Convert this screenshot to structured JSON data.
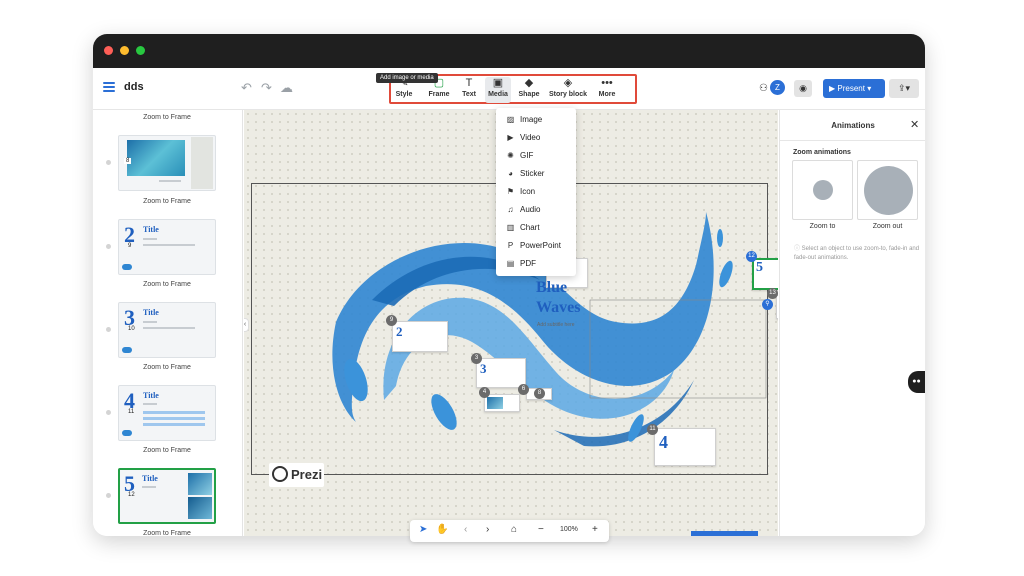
{
  "document": {
    "title": "dds"
  },
  "toolbar": {
    "undo": "↶",
    "redo": "↷",
    "cloud": "☁",
    "tools": [
      {
        "name": "Style",
        "icon": "✎"
      },
      {
        "name": "Frame",
        "icon": "▢"
      },
      {
        "name": "Text",
        "icon": "T"
      },
      {
        "name": "Media",
        "icon": "▣"
      },
      {
        "name": "Shape",
        "icon": "◆"
      },
      {
        "name": "Story block",
        "icon": "◈"
      },
      {
        "name": "More",
        "icon": "•••"
      }
    ],
    "tooltip": "Add image or media",
    "avatar_letter": "Z",
    "present_label": "Present",
    "present_icon": "▶",
    "share_icon": "⇪"
  },
  "media_menu": {
    "items": [
      {
        "label": "Image",
        "icon": "▨"
      },
      {
        "label": "Video",
        "icon": "▶"
      },
      {
        "label": "GIF",
        "icon": "✺"
      },
      {
        "label": "Sticker",
        "icon": "◕"
      },
      {
        "label": "Icon",
        "icon": "⚑"
      },
      {
        "label": "Audio",
        "icon": "♫"
      },
      {
        "label": "Chart",
        "icon": "▥"
      },
      {
        "label": "PowerPoint",
        "icon": "P"
      },
      {
        "label": "PDF",
        "icon": "▤"
      }
    ]
  },
  "left_panel": {
    "zoom_to_frame": "Zoom to Frame",
    "slides": [
      {
        "index": "8",
        "number": "",
        "title": ""
      },
      {
        "index": "9",
        "number": "2",
        "title": "Title"
      },
      {
        "index": "10",
        "number": "3",
        "title": "Title"
      },
      {
        "index": "11",
        "number": "4",
        "title": "Title"
      },
      {
        "index": "12",
        "number": "5",
        "title": "Title"
      }
    ]
  },
  "canvas": {
    "main_title_line1": "Blue",
    "main_title_line2": "Waves",
    "main_subtitle": "Add subtitle here",
    "badges": [
      "10",
      "9",
      "3",
      "4",
      "6",
      "8",
      "11",
      "12",
      "13"
    ],
    "logo_text": "Prezi"
  },
  "bottom_bar": {
    "zoom": "100%",
    "minus": "−",
    "plus": "+"
  },
  "right_panel": {
    "title": "Animations",
    "section": "Zoom animations",
    "zoom_to": "Zoom to",
    "zoom_out": "Zoom out",
    "hint": "Select an object to use zoom-to, fade-in and fade-out animations."
  },
  "colors": {
    "accent_blue": "#2b6fd6",
    "highlight_red": "#e04a3a",
    "selection_green": "#22a046",
    "wave_blue": "#2f86d2"
  }
}
